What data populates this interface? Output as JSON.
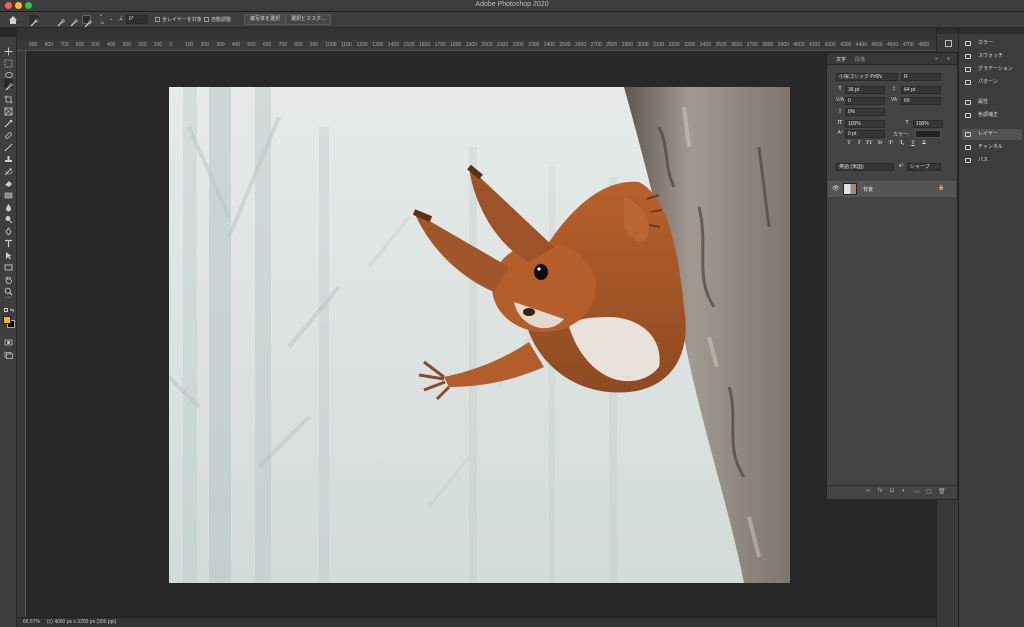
{
  "window": {
    "title": "Adobe Photoshop 2020"
  },
  "colors": {
    "close": "#fe5f57",
    "minimize": "#febc2e",
    "zoom": "#28c840",
    "foreground": "#f5b800",
    "background": "#000000"
  },
  "options_bar": {
    "brush_size": "11",
    "angle": "0°",
    "sample_all_layers": "全レイヤーを対象",
    "auto_enhance": "自動調整",
    "select_subject": "被写体を選択",
    "select_and_mask": "選択とマスク..."
  },
  "ruler": {
    "h_ticks": [
      "900",
      "800",
      "700",
      "600",
      "500",
      "400",
      "300",
      "200",
      "100",
      "0",
      "100",
      "200",
      "300",
      "400",
      "500",
      "600",
      "700",
      "800",
      "900",
      "1000",
      "1100",
      "1200",
      "1300",
      "1400",
      "1500",
      "1600",
      "1700",
      "1800",
      "1900",
      "2000",
      "2100",
      "2200",
      "2300",
      "2400",
      "2500",
      "2600",
      "2700",
      "2800",
      "2900",
      "3000",
      "3100",
      "3200",
      "3300",
      "3400",
      "3500",
      "3600",
      "3700",
      "3800",
      "3900",
      "4000",
      "4100",
      "4200",
      "4300",
      "4400",
      "4500",
      "4600",
      "4700",
      "4800"
    ]
  },
  "status": {
    "zoom": "66.67%",
    "doc_info": "(c) 4000 px x 3200 px (300 ppi)"
  },
  "character_panel": {
    "tabs": [
      "文字",
      "段落"
    ],
    "font_family": "小塚ゴシック Pr6N",
    "font_style": "R",
    "font_size": "36 pt",
    "leading": "64 pt",
    "kerning": "0",
    "tracking": "60",
    "tsume": "0%",
    "vertical_scale": "100%",
    "horizontal_scale": "100%",
    "baseline_shift": "0 pt",
    "color_label": "カラー:",
    "language": "英語 (米国)",
    "antialias": "シャープ",
    "type_buttons": [
      "T",
      "T",
      "TT",
      "Tr",
      "T¹",
      "T₁",
      "T",
      "T"
    ]
  },
  "layers": {
    "background_layer": "背景",
    "lock": "🔒",
    "footer_icons": [
      "∞",
      "fx",
      "◘",
      "◐",
      "▭",
      "▢",
      "🗑"
    ]
  },
  "right_panel": {
    "items": [
      {
        "label": "カラー",
        "icon": "color-wheel-icon"
      },
      {
        "label": "スウォッチ",
        "icon": "swatches-icon"
      },
      {
        "label": "グラデーション",
        "icon": "gradient-icon"
      },
      {
        "label": "パターン",
        "icon": "pattern-icon"
      },
      {
        "label": "属性",
        "icon": "properties-icon"
      },
      {
        "label": "色調補正",
        "icon": "adjustments-icon"
      },
      {
        "label": "レイヤー",
        "icon": "layers-icon"
      },
      {
        "label": "チャンネル",
        "icon": "channels-icon"
      },
      {
        "label": "パス",
        "icon": "paths-icon"
      }
    ]
  }
}
